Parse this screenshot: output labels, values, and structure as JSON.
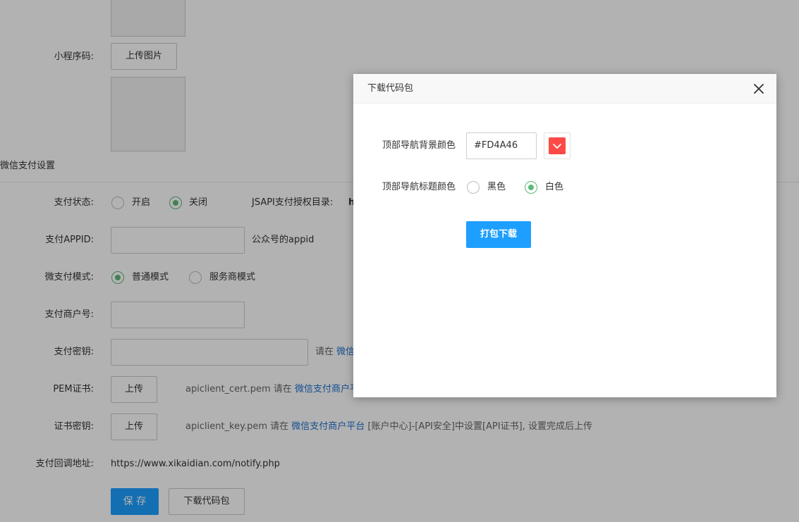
{
  "background": {
    "miniprogram_code_label": "小程序码:",
    "upload_image_btn": "上传图片",
    "section_title": "微信支付设置",
    "pay_status_label": "支付状态:",
    "pay_status_on": "开启",
    "pay_status_off": "关闭",
    "jsapi_text": "JSAPI支付授权目录:",
    "jsapi_value_start": "h",
    "appid_label": "支付APPID:",
    "appid_hint": "公众号的appid",
    "mode_label": "微支付模式:",
    "mode_normal": "普通模式",
    "mode_service": "服务商模式",
    "merchant_no_label": "支付商户号:",
    "secret_label": "支付密钥:",
    "secret_hint_prefix": "请在",
    "secret_hint_link": "微信",
    "pem_label": "PEM证书:",
    "pem_upload_btn": "上传",
    "pem_hint_prefix": "apiclient_cert.pem 请在",
    "pem_hint_link": "微信支付商户平",
    "key_label": "证书密钥:",
    "key_upload_btn": "上传",
    "key_hint_prefix": "apiclient_key.pem 请在",
    "key_hint_link": "微信支付商户平台",
    "key_hint_suffix": "[账户中心]-[API安全]中设置[API证书], 设置完成后上传",
    "notify_label": "支付回调地址:",
    "notify_value": "https://www.xikaidian.com/notify.php",
    "save_btn": "保 存",
    "download_btn": "下载代码包"
  },
  "modal": {
    "title": "下载代码包",
    "nav_bg_label": "顶部导航背景颜色",
    "nav_bg_value": "#FD4A46",
    "nav_bg_swatch_color": "#FD4A46",
    "nav_title_label": "顶部导航标题颜色",
    "nav_title_black": "黑色",
    "nav_title_white": "白色",
    "pack_download_btn": "打包下载"
  }
}
